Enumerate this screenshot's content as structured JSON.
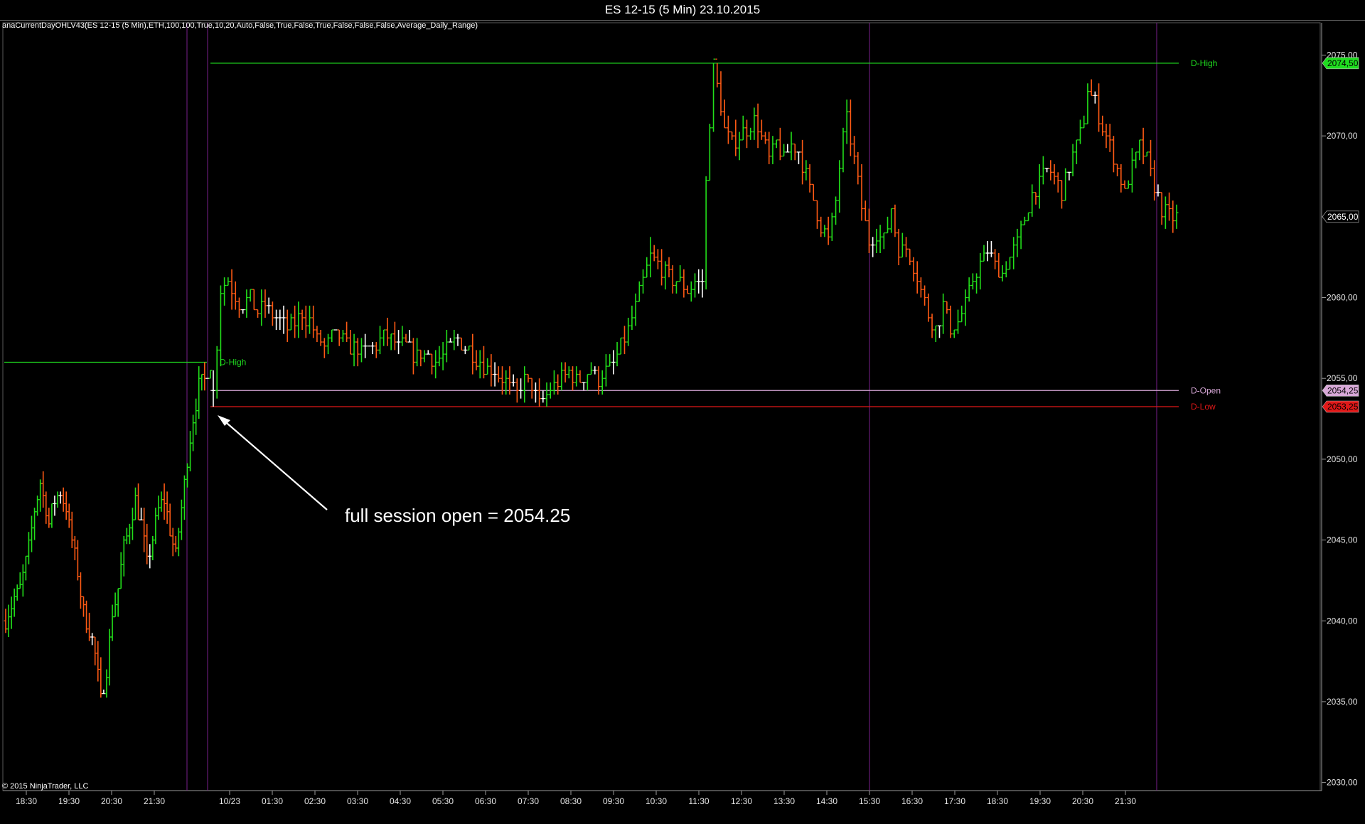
{
  "window": {
    "title": "ES 12-15 (5 Min)  23.10.2015"
  },
  "indicator_label": "anaCurrentDayOHLV43(ES 12-15 (5 Min),ETH,100,100,True,10,20,Auto,False,True,False,True,False,False,False,Average_Daily_Range)",
  "copyright": "© 2015 NinjaTrader, LLC",
  "annotation": {
    "text": "full session open = 2054.25"
  },
  "colors": {
    "background": "#000000",
    "up_bar": "#22e01a",
    "down_bar": "#ff5a14",
    "doji_bar": "#ffffff",
    "session_divider": "#7a1f8c",
    "d_high": "#1fdc1f",
    "d_open": "#d8a8d8",
    "d_low": "#e01818"
  },
  "chart_data": {
    "type": "candlestick",
    "title": "ES 12-15 (5 Min)  23.10.2015",
    "xlabel": "",
    "ylabel": "",
    "ylim": [
      2029.5,
      2077
    ],
    "grid": false,
    "y_ticks": [
      "2030,00",
      "2035,00",
      "2040,00",
      "2045,00",
      "2050,00",
      "2055,00",
      "2060,00",
      "2065,00",
      "2070,00",
      "2075,00"
    ],
    "x_ticks": [
      "18:30",
      "19:30",
      "20:30",
      "21:30",
      "10/23",
      "01:30",
      "02:30",
      "03:30",
      "04:30",
      "05:30",
      "06:30",
      "07:30",
      "08:30",
      "09:30",
      "10:30",
      "11:30",
      "12:30",
      "13:30",
      "14:30",
      "15:30",
      "16:30",
      "17:30",
      "18:30",
      "19:30",
      "20:30",
      "21:30"
    ],
    "horizontal_lines": [
      {
        "name": "D-High",
        "value": 2074.5,
        "tag": "2074,50"
      },
      {
        "name": "D-Open",
        "value": 2054.25,
        "tag": "2054,25"
      },
      {
        "name": "D-Low",
        "value": 2053.25,
        "tag": "2053,25"
      }
    ],
    "previous_session_high": {
      "name": "D-High",
      "value": 2056.0
    },
    "current_price": {
      "value": 2065.0,
      "tag": "2065,00"
    },
    "path": [
      [
        0,
        2040.0
      ],
      [
        3,
        2041.5
      ],
      [
        5,
        2042.0
      ],
      [
        8,
        2044.5
      ],
      [
        10,
        2047.0
      ],
      [
        12,
        2048.5
      ],
      [
        14,
        2047.0
      ],
      [
        15,
        2046.0
      ],
      [
        17,
        2047.5
      ],
      [
        19,
        2048.0
      ],
      [
        21,
        2047.0
      ],
      [
        23,
        2045.0
      ],
      [
        25,
        2043.0
      ],
      [
        27,
        2040.5
      ],
      [
        29,
        2039.5
      ],
      [
        31,
        2038.0
      ],
      [
        33,
        2035.0
      ],
      [
        35,
        2037.0
      ],
      [
        37,
        2040.5
      ],
      [
        39,
        2042.0
      ],
      [
        41,
        2044.5
      ],
      [
        43,
        2046.0
      ],
      [
        45,
        2047.5
      ],
      [
        47,
        2046.0
      ],
      [
        49,
        2043.5
      ],
      [
        51,
        2045.0
      ],
      [
        53,
        2047.0
      ],
      [
        55,
        2047.5
      ],
      [
        57,
        2045.5
      ],
      [
        59,
        2044.0
      ],
      [
        61,
        2047.0
      ],
      [
        63,
        2050.0
      ],
      [
        65,
        2052.5
      ],
      [
        67,
        2054.5
      ],
      [
        69,
        2055.0
      ],
      [
        70,
        2055.5
      ],
      [
        71,
        2056.0
      ],
      [
        72,
        2054.25
      ],
      [
        73,
        2057.0
      ],
      [
        74,
        2060.5
      ],
      [
        76,
        2061.0
      ],
      [
        78,
        2060.0
      ],
      [
        80,
        2059.5
      ],
      [
        82,
        2060.0
      ],
      [
        84,
        2059.0
      ],
      [
        86,
        2059.5
      ],
      [
        88,
        2059.0
      ],
      [
        90,
        2058.5
      ],
      [
        92,
        2058.0
      ],
      [
        94,
        2058.5
      ],
      [
        96,
        2059.0
      ],
      [
        98,
        2058.5
      ],
      [
        100,
        2057.5
      ],
      [
        102,
        2057.0
      ],
      [
        104,
        2057.5
      ],
      [
        106,
        2057.5
      ],
      [
        108,
        2057.0
      ],
      [
        110,
        2057.0
      ],
      [
        112,
        2056.5
      ],
      [
        114,
        2057.0
      ],
      [
        116,
        2057.0
      ],
      [
        118,
        2057.5
      ],
      [
        120,
        2057.5
      ],
      [
        122,
        2057.0
      ],
      [
        124,
        2057.0
      ],
      [
        126,
        2056.5
      ],
      [
        128,
        2056.5
      ],
      [
        130,
        2056.5
      ],
      [
        132,
        2056.0
      ],
      [
        134,
        2056.5
      ],
      [
        136,
        2057.0
      ],
      [
        138,
        2057.5
      ],
      [
        140,
        2057.0
      ],
      [
        142,
        2056.5
      ],
      [
        144,
        2056.0
      ],
      [
        146,
        2055.5
      ],
      [
        148,
        2055.5
      ],
      [
        150,
        2055.0
      ],
      [
        152,
        2054.5
      ],
      [
        154,
        2054.0
      ],
      [
        156,
        2055.0
      ],
      [
        158,
        2054.5
      ],
      [
        160,
        2053.5
      ],
      [
        162,
        2054.0
      ],
      [
        164,
        2054.5
      ],
      [
        166,
        2055.0
      ],
      [
        168,
        2055.5
      ],
      [
        170,
        2055.0
      ],
      [
        172,
        2055.0
      ],
      [
        174,
        2055.5
      ],
      [
        176,
        2055.0
      ],
      [
        178,
        2055.5
      ],
      [
        180,
        2056.0
      ],
      [
        182,
        2057.0
      ],
      [
        184,
        2058.0
      ],
      [
        186,
        2059.5
      ],
      [
        188,
        2061.0
      ],
      [
        190,
        2062.5
      ],
      [
        192,
        2062.0
      ],
      [
        194,
        2061.5
      ],
      [
        196,
        2061.0
      ],
      [
        198,
        2061.0
      ],
      [
        200,
        2060.5
      ],
      [
        202,
        2061.0
      ],
      [
        204,
        2061.0
      ],
      [
        205,
        2067.0
      ],
      [
        206,
        2071.0
      ],
      [
        207,
        2074.5
      ],
      [
        208,
        2073.0
      ],
      [
        210,
        2070.5
      ],
      [
        212,
        2069.5
      ],
      [
        214,
        2070.0
      ],
      [
        216,
        2070.5
      ],
      [
        218,
        2071.0
      ],
      [
        220,
        2070.0
      ],
      [
        222,
        2068.5
      ],
      [
        224,
        2069.5
      ],
      [
        226,
        2068.5
      ],
      [
        228,
        2069.5
      ],
      [
        230,
        2069.0
      ],
      [
        232,
        2067.5
      ],
      [
        234,
        2066.0
      ],
      [
        236,
        2064.5
      ],
      [
        238,
        2063.5
      ],
      [
        240,
        2066.0
      ],
      [
        242,
        2070.0
      ],
      [
        243,
        2071.0
      ],
      [
        245,
        2068.5
      ],
      [
        247,
        2065.5
      ],
      [
        249,
        2063.5
      ],
      [
        251,
        2064.0
      ],
      [
        253,
        2063.5
      ],
      [
        255,
        2065.5
      ],
      [
        257,
        2063.0
      ],
      [
        259,
        2063.0
      ],
      [
        261,
        2062.0
      ],
      [
        263,
        2060.5
      ],
      [
        265,
        2059.0
      ],
      [
        267,
        2058.0
      ],
      [
        269,
        2059.5
      ],
      [
        271,
        2058.0
      ],
      [
        273,
        2058.5
      ],
      [
        275,
        2059.5
      ],
      [
        277,
        2061.0
      ],
      [
        279,
        2062.0
      ],
      [
        281,
        2063.0
      ],
      [
        283,
        2062.0
      ],
      [
        285,
        2061.5
      ],
      [
        287,
        2062.5
      ],
      [
        289,
        2063.5
      ],
      [
        291,
        2065.0
      ],
      [
        293,
        2066.5
      ],
      [
        295,
        2067.0
      ],
      [
        297,
        2068.0
      ],
      [
        299,
        2067.5
      ],
      [
        301,
        2066.5
      ],
      [
        303,
        2068.0
      ],
      [
        305,
        2069.5
      ],
      [
        307,
        2071.0
      ],
      [
        308,
        2073.0
      ],
      [
        310,
        2072.0
      ],
      [
        312,
        2070.5
      ],
      [
        314,
        2069.5
      ],
      [
        316,
        2068.0
      ],
      [
        318,
        2066.5
      ],
      [
        320,
        2068.0
      ],
      [
        322,
        2069.5
      ],
      [
        324,
        2068.5
      ],
      [
        326,
        2067.0
      ],
      [
        328,
        2065.5
      ],
      [
        330,
        2065.0
      ],
      [
        332,
        2065.0
      ]
    ]
  }
}
